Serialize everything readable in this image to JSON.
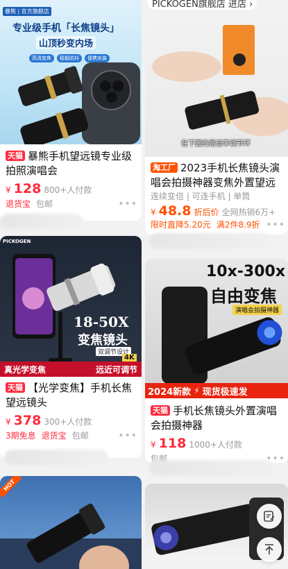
{
  "left": {
    "card1": {
      "img_banner": "专业级手机「长焦镜头」",
      "img_sub": "山顶秒变内场",
      "img_badges": [
        "高清变焦",
        "稳稳防抖",
        "便携安装"
      ],
      "img_brand": "暴熊 | 官方旗舰店",
      "tag": "天猫",
      "title": "暴熊手机望远镜专业级拍照演唱会",
      "yen": "¥",
      "price": "128",
      "sold": "800+人付款",
      "meta": [
        "退货宝",
        "包邮"
      ]
    },
    "card2": {
      "img_line1": "18-50X",
      "img_line2": "变焦镜头",
      "img_line3": "双调节设计",
      "img_bottom_left": "真光学变焦",
      "img_bottom_right": "远近可调节",
      "img_badge": "4K",
      "img_brand": "PICKOGEN",
      "tag": "天猫",
      "title": "【光学变焦】手机长焦望远镜头",
      "yen": "¥",
      "price": "378",
      "sold": "300+人付款",
      "meta": [
        "3期免息",
        "退货宝",
        "包邮"
      ]
    },
    "card3": {
      "hot": "HOT"
    }
  },
  "right": {
    "top_store": "PICKOGEN旗舰店 进店 ›",
    "card1": {
      "caption": "在下面的是倍率调节环",
      "tag": "淘工厂",
      "title": "2023手机长焦镜头演唱会拍摄神器变焦外置望远",
      "meta1": "连续变倍 | 可连手机 | 单筒",
      "yen": "¥",
      "price": "48.8",
      "discount": "折后价",
      "sold": "全网热销6万+",
      "promo1": "限时直降5.20元",
      "promo2": "满2件8.9折"
    },
    "card2": {
      "img_line1": "10x-300x",
      "img_line2": "自由变焦",
      "img_tag": "演唱会拍摄神器",
      "img_bottom_left": "2024新款",
      "img_bottom_right": "现货极速发",
      "tag": "天猫",
      "title": "手机长焦镜头外置演唱会拍摄神器",
      "yen": "¥",
      "price": "118",
      "sold": "1000+人付款",
      "meta": [
        "包邮"
      ]
    }
  },
  "colors": {
    "red": "#ff2a3c",
    "orange": "#ff5000"
  }
}
